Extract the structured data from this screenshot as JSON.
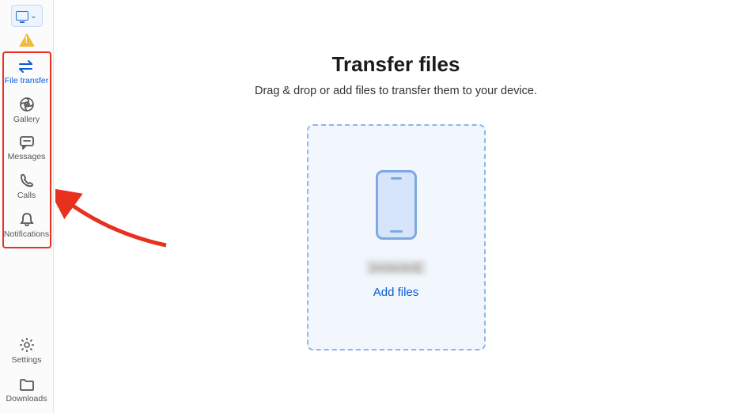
{
  "sidebar": {
    "items": [
      {
        "label": "File transfer",
        "icon": "transfer-icon",
        "active": true
      },
      {
        "label": "Gallery",
        "icon": "gallery-icon",
        "active": false
      },
      {
        "label": "Messages",
        "icon": "messages-icon",
        "active": false
      },
      {
        "label": "Calls",
        "icon": "calls-icon",
        "active": false
      },
      {
        "label": "Notifications",
        "icon": "bell-icon",
        "active": false
      }
    ],
    "bottom": [
      {
        "label": "Settings",
        "icon": "settings-icon"
      },
      {
        "label": "Downloads",
        "icon": "downloads-icon"
      }
    ]
  },
  "main": {
    "title": "Transfer files",
    "subtitle": "Drag & drop or add files to transfer them to your device.",
    "device_name": "[redacted]",
    "add_files": "Add files"
  },
  "colors": {
    "accent": "#0a5bd6",
    "dropzone_border": "#8fb6e7",
    "dropzone_bg": "#f2f7fe",
    "annotation": "#e8301f"
  },
  "annotation": {
    "type": "arrow-and-box",
    "note": "red box around sidebar nav items with arrow pointing at it"
  }
}
